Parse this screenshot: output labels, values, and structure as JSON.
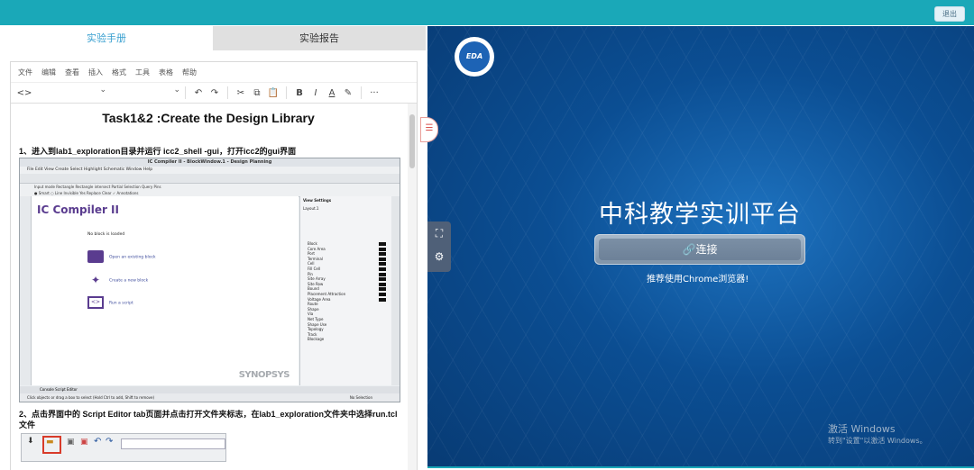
{
  "topbar": {
    "logout_label": "退出"
  },
  "tabs": [
    {
      "label": "实验手册"
    },
    {
      "label": "实验报告"
    }
  ],
  "editor": {
    "menu": [
      "文件",
      "编辑",
      "查看",
      "插入",
      "格式",
      "工具",
      "表格",
      "帮助"
    ],
    "toolbar": {
      "code": "<>",
      "undo": "↶",
      "redo": "↷",
      "cut": "✂",
      "copy": "⧉",
      "paste": "📋",
      "bold": "B",
      "italic": "I",
      "font_color": "A",
      "highlight": "✎",
      "more": "···"
    }
  },
  "doc": {
    "title": "Task1&2 :Create the Design Library",
    "step1": "1、进入到lab1_exploration目录并运行 icc2_shell -gui，打开icc2的gui界面",
    "step2": "2、点击界面中的 Script Editor tab页面并点击打开文件夹标志，在lab1_exploration文件夹中选择run.tcl文件"
  },
  "icc": {
    "window_title": "IC Compiler II - BlockWindow.1 - Design Planning",
    "menu": "File  Edit  View  Create  Select  Highlight  Schematic  Window  Help",
    "options_row1": "Input mode   Rectangle   Rectangle intersect   Partial   Selection   Query   Pins",
    "options_row2": "● Smart   ○ Line   Invisible   Yes   Replace   Clear   ✓ Annotations",
    "brand": "IC Compiler II",
    "no_block": "No block is loaded",
    "actions": [
      "Open an existing block",
      "Create a new block",
      "Run a script"
    ],
    "synopsys": "SYNOPSYS",
    "view_settings_title": "View Settings",
    "view_settings_tab": "Layout.1",
    "layers": [
      "Block",
      "Core Area",
      "Port",
      "Terminal",
      "Cell",
      "Fill Cell",
      "Pin",
      "Site Array",
      "Site Row",
      "Bound",
      "Placement Attraction",
      "Voltage Area",
      "Route",
      "Shape",
      "Via",
      "Net Type",
      "Shape Use",
      "Topology",
      "Track",
      "Blockage"
    ],
    "bottom_tabs": "Console   Script Editor",
    "status_left": "Click objects or drag a box to select (Hold Ctrl to add, Shift to remove)",
    "status_right": "No Selection"
  },
  "right": {
    "logo_text": "EDA",
    "title": "中科教学实训平台",
    "connect_label": "🔗连接",
    "hint": "推荐使用Chrome浏览器!",
    "watermark_line1": "激活 Windows",
    "watermark_line2": "转到\"设置\"以激活 Windows。"
  },
  "colors": {
    "topbar": "#1aa8b8",
    "panel_bg": "#0b4d8e",
    "tab_active_text": "#39a0d0"
  }
}
